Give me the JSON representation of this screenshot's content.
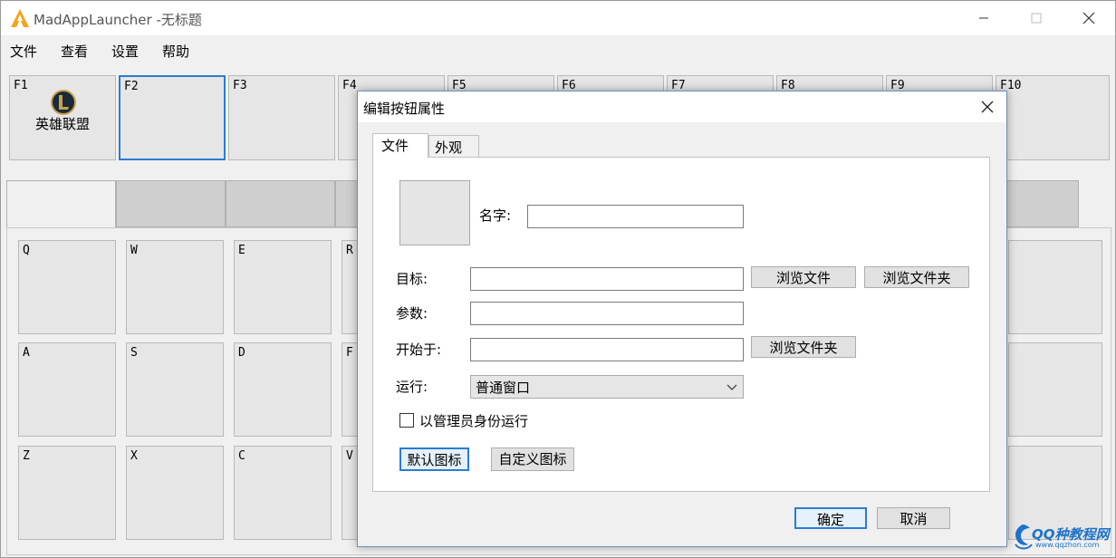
{
  "window": {
    "title": "MadAppLauncher -无标题",
    "controls": {
      "minimize": "—",
      "maximize": "☐",
      "close": "✕"
    }
  },
  "menubar": [
    "文件",
    "查看",
    "设置",
    "帮助"
  ],
  "fkeys": [
    {
      "label": "F1",
      "app_name": "英雄联盟"
    },
    {
      "label": "F2"
    },
    {
      "label": "F3"
    },
    {
      "label": "F4"
    },
    {
      "label": "F5"
    },
    {
      "label": "F6"
    },
    {
      "label": "F7"
    },
    {
      "label": "F8"
    },
    {
      "label": "F9"
    },
    {
      "label": "F10"
    }
  ],
  "keys": {
    "row1": [
      "Q",
      "W",
      "E",
      "R"
    ],
    "row2": [
      "A",
      "S",
      "D",
      "F"
    ],
    "row3": [
      "Z",
      "X",
      "C",
      "V"
    ]
  },
  "dialog": {
    "title": "编辑按钮属性",
    "tabs": [
      "文件",
      "外观"
    ],
    "name_label": "名字:",
    "name_value": "",
    "target_label": "目标:",
    "target_value": "",
    "args_label": "参数:",
    "args_value": "",
    "start_label": "开始于:",
    "start_value": "",
    "run_label": "运行:",
    "run_value": "普通窗口",
    "browse_file": "浏览文件",
    "browse_folder": "浏览文件夹",
    "browse_folder2": "浏览文件夹",
    "admin_label": "以管理员身份运行",
    "default_icon": "默认图标",
    "custom_icon": "自定义图标",
    "ok": "确定",
    "cancel": "取消"
  },
  "watermark": {
    "text": "QQ种教程网",
    "url": "www.qqzhon.com"
  },
  "colors": {
    "selection": "#2b7bd4",
    "window_bg": "#f0f0f0"
  }
}
